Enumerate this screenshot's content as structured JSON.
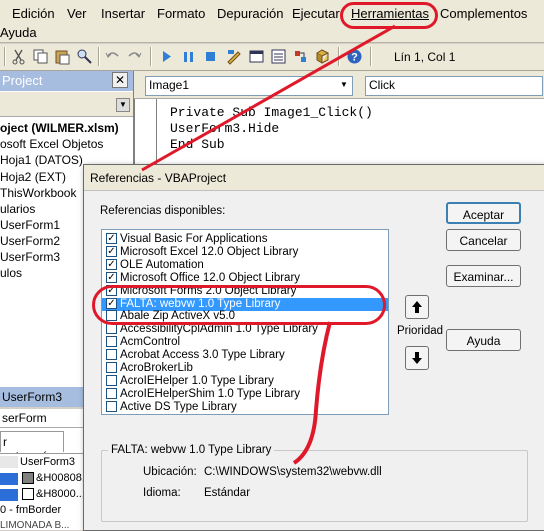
{
  "menu": {
    "items": [
      "Edición",
      "Ver",
      "Insertar",
      "Formato",
      "Depuración",
      "Ejecutar",
      "Herramientas",
      "Complementos"
    ],
    "second_row": "Ayuda"
  },
  "toolbar": {
    "position": "Lín 1, Col 1"
  },
  "project_panel": {
    "title": "Project",
    "tree": [
      "oject (WILMER.xlsm)",
      "osoft Excel Objetos",
      "Hoja1 (DATOS)",
      "Hoja2 (EXT)",
      "ThisWorkbook",
      "ularios",
      "UserForm1",
      "UserForm2",
      "UserForm3",
      "ulos"
    ]
  },
  "properties_panel": {
    "title": "UserForm3",
    "selector": "serForm",
    "tab": "r categorías",
    "rows": [
      {
        "name": "",
        "value": "UserForm3"
      },
      {
        "name": "",
        "value": "&H00808..."
      },
      {
        "name": "",
        "value": "&H8000..."
      },
      {
        "name": "",
        "value": "0 - fmBorder"
      },
      {
        "name": "",
        "value": "LIMONADA B..."
      }
    ]
  },
  "code_window": {
    "object_combo": "Image1",
    "procedure_combo": "Click",
    "lines": [
      "Private Sub Image1_Click()",
      "UserForm3.Hide",
      "End Sub"
    ]
  },
  "dialog": {
    "title": "Referencias - VBAProject",
    "list_label": "Referencias disponibles:",
    "references": [
      {
        "label": "Visual Basic For Applications",
        "checked": true
      },
      {
        "label": "Microsoft Excel 12.0 Object Library",
        "checked": true
      },
      {
        "label": "OLE Automation",
        "checked": true
      },
      {
        "label": "Microsoft Office 12.0 Object Library",
        "checked": true
      },
      {
        "label": "Microsoft Forms 2.0 Object Library",
        "checked": true
      },
      {
        "label": "FALTA: webvw 1.0 Type Library",
        "checked": true,
        "selected": true
      },
      {
        "label": "Abale Zip ActiveX v5.0",
        "checked": false
      },
      {
        "label": "AccessibilityCplAdmin 1.0 Type Library",
        "checked": false
      },
      {
        "label": "AcmControl",
        "checked": false
      },
      {
        "label": "Acrobat Access 3.0 Type Library",
        "checked": false
      },
      {
        "label": "AcroBrokerLib",
        "checked": false
      },
      {
        "label": "AcroIEHelper 1.0 Type Library",
        "checked": false
      },
      {
        "label": "AcroIEHelperShim 1.0 Type Library",
        "checked": false
      },
      {
        "label": "Active DS Type Library",
        "checked": false
      }
    ],
    "buttons": {
      "accept": "Aceptar",
      "cancel": "Cancelar",
      "browse": "Examinar...",
      "help": "Ayuda"
    },
    "priority_label": "Prioridad",
    "info": {
      "group_title": "FALTA: webvw 1.0 Type Library",
      "location_label": "Ubicación:",
      "location_value": "C:\\WINDOWS\\system32\\webvw.dll",
      "language_label": "Idioma:",
      "language_value": "Estándar"
    }
  },
  "colors": {
    "annotation": "#e0192a",
    "selection": "#3399ff",
    "panel_title": "#a6bde0"
  }
}
